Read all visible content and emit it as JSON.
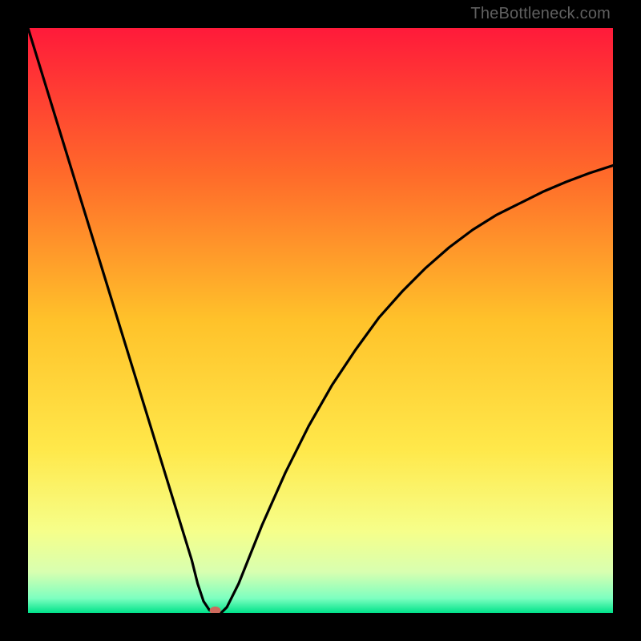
{
  "watermark": "TheBottleneck.com",
  "chart_data": {
    "type": "line",
    "title": "",
    "xlabel": "",
    "ylabel": "",
    "xlim": [
      0,
      100
    ],
    "ylim": [
      0,
      100
    ],
    "series": [
      {
        "name": "bottleneck-curve",
        "x": [
          0,
          2,
          4,
          6,
          8,
          10,
          12,
          14,
          16,
          18,
          20,
          22,
          24,
          26,
          28,
          29,
          30,
          31,
          32,
          33,
          34,
          36,
          38,
          40,
          44,
          48,
          52,
          56,
          60,
          64,
          68,
          72,
          76,
          80,
          84,
          88,
          92,
          96,
          100
        ],
        "y": [
          100,
          93.5,
          87,
          80.5,
          74,
          67.5,
          61,
          54.5,
          48,
          41.5,
          35,
          28.5,
          22,
          15.5,
          9,
          5,
          2,
          0.5,
          0,
          0,
          1,
          5,
          10,
          15,
          24,
          32,
          39,
          45,
          50.5,
          55,
          59,
          62.5,
          65.5,
          68,
          70,
          72,
          73.7,
          75.2,
          76.5
        ]
      }
    ],
    "marker": {
      "x": 32,
      "y": 0,
      "color": "#cf6a5d"
    },
    "gradient_stops": [
      {
        "offset": 0.0,
        "color": "#ff1a3a"
      },
      {
        "offset": 0.25,
        "color": "#ff6a2a"
      },
      {
        "offset": 0.5,
        "color": "#ffc22a"
      },
      {
        "offset": 0.72,
        "color": "#ffe84a"
      },
      {
        "offset": 0.86,
        "color": "#f6ff8a"
      },
      {
        "offset": 0.93,
        "color": "#d8ffb0"
      },
      {
        "offset": 0.975,
        "color": "#7dffc0"
      },
      {
        "offset": 1.0,
        "color": "#00e28a"
      }
    ]
  }
}
